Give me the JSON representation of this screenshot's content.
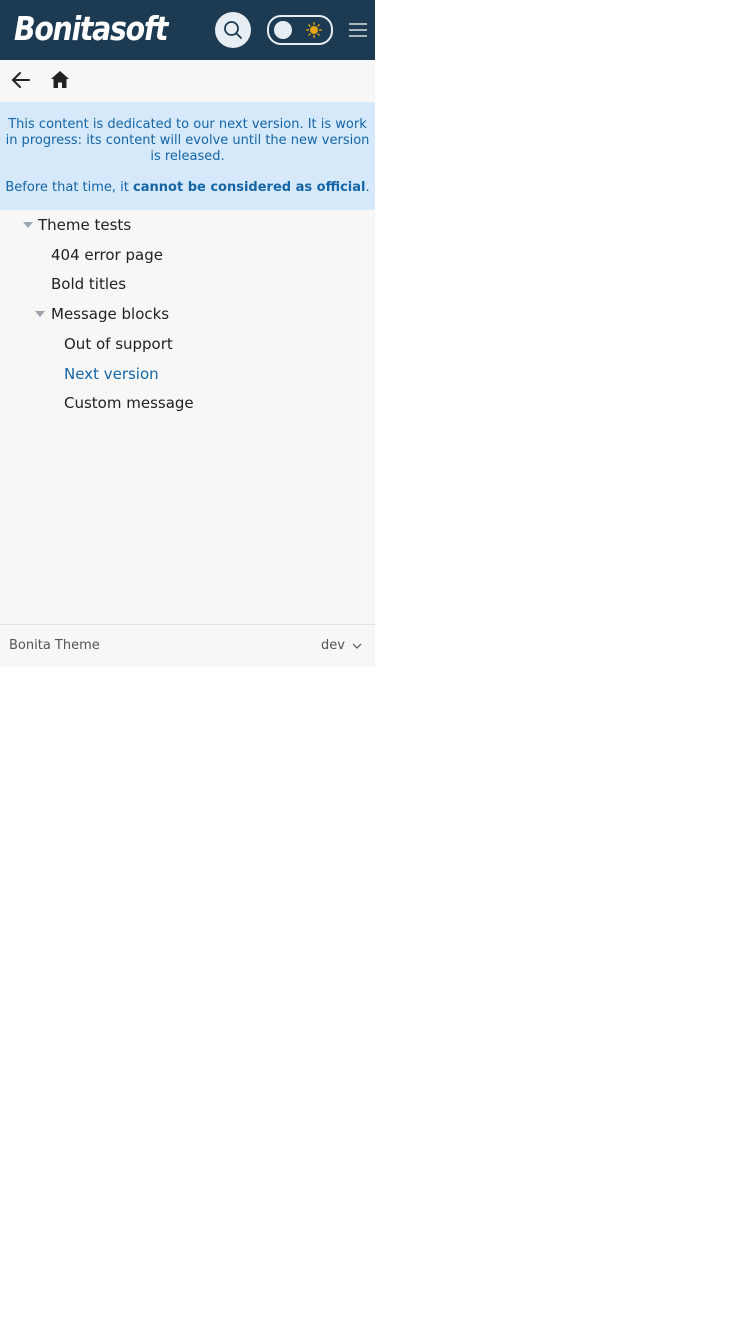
{
  "header": {
    "logo_text": "Bonitasoft",
    "icons": {
      "search": "search-icon",
      "theme_toggle": "theme-toggle",
      "sun": "sun-icon",
      "menu": "hamburger-menu-icon"
    },
    "colors": {
      "background": "#1c3b52",
      "sun": "#e8a317"
    }
  },
  "toolbar": {
    "icons": {
      "back": "arrow-left-icon",
      "home": "home-icon"
    }
  },
  "notice": {
    "line1": "This content is dedicated to our next version. It is work in progress: its content will evolve until the new version is released.",
    "line2_prefix": "Before that time, it ",
    "line2_strong": "cannot be considered as official",
    "line2_suffix": ".",
    "colors": {
      "background": "#d6e9fa",
      "text": "#1565a7"
    }
  },
  "nav": {
    "items": [
      {
        "label": "Theme tests",
        "level": 1,
        "expanded": true
      },
      {
        "label": "404 error page",
        "level": 2
      },
      {
        "label": "Bold titles",
        "level": 2
      },
      {
        "label": "Message blocks",
        "level": 2,
        "expanded": true
      },
      {
        "label": "Out of support",
        "level": 3
      },
      {
        "label": "Next version",
        "level": 3,
        "current": true
      },
      {
        "label": "Custom message",
        "level": 3
      }
    ]
  },
  "footer": {
    "title": "Bonita Theme",
    "version": "dev"
  }
}
